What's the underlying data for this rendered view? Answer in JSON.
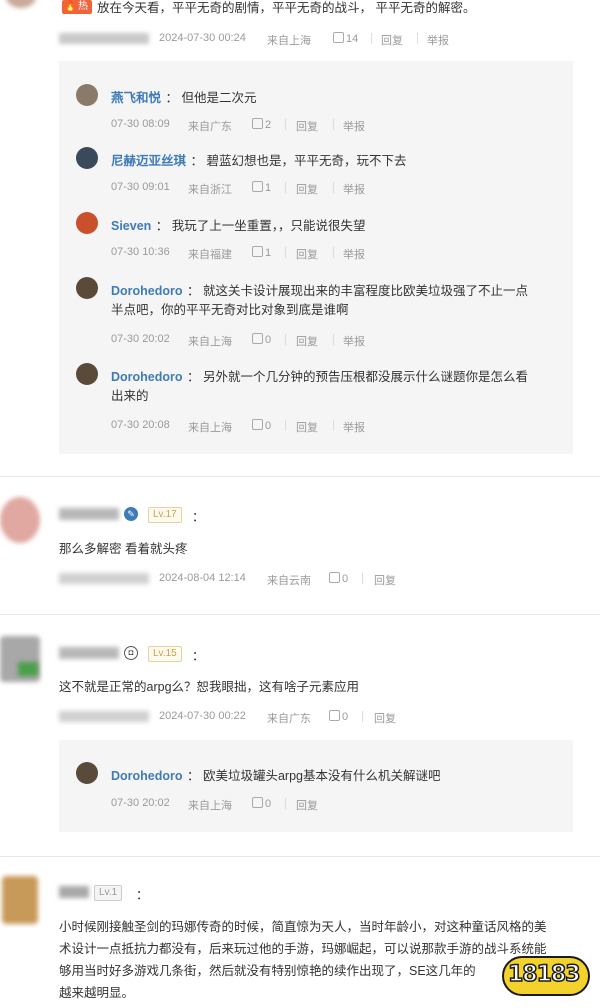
{
  "top_comment": {
    "hot_badge": "热",
    "text": "放在今天看，平平无奇的剧情，平平无奇的战斗， 平平无奇的解密。",
    "date": "2024-07-30 00:24",
    "location": "来自上海",
    "likes": "14",
    "reply_label": "回复",
    "report_label": "举报",
    "replies": [
      {
        "name": "燕飞和悦",
        "text": "但他是二次元",
        "date": "07-30 08:09",
        "location": "来自广东",
        "likes": "2",
        "reply_label": "回复",
        "report_label": "举报",
        "avatar_color": "#8a7a6a"
      },
      {
        "name": "尼赫迈亚丝琪",
        "text": "碧蓝幻想也是，平平无奇，玩不下去",
        "date": "07-30 09:01",
        "location": "来自浙江",
        "likes": "1",
        "reply_label": "回复",
        "report_label": "举报",
        "avatar_color": "#3a4a5a"
      },
      {
        "name": "Sieven",
        "text": "我玩了上一坐重置，，只能说很失望",
        "date": "07-30 10:36",
        "location": "来自福建",
        "likes": "1",
        "reply_label": "回复",
        "report_label": "举报",
        "avatar_color": "#c8502a"
      },
      {
        "name": "Dorohedoro",
        "text_line1": "就这关卡设计展现出来的丰富程度比欧美垃圾强了不止一点",
        "text_line2": "半点吧，你的平平无奇对比对象到底是谁啊",
        "date": "07-30 20:02",
        "location": "来自上海",
        "likes": "0",
        "reply_label": "回复",
        "report_label": "举报",
        "avatar_color": "#5a4a3a"
      },
      {
        "name": "Dorohedoro",
        "text_line1": "另外就一个几分钟的预告压根都没展示什么谜题你是怎么看",
        "text_line2": "出来的",
        "date": "07-30 20:08",
        "location": "来自上海",
        "likes": "0",
        "reply_label": "回复",
        "report_label": "举报",
        "avatar_color": "#5a4a3a"
      }
    ]
  },
  "comment2": {
    "level": "Lv.17",
    "text": "那么多解密 看着就头疼",
    "date": "2024-08-04 12:14",
    "location": "来自云南",
    "likes": "0",
    "reply_label": "回复"
  },
  "comment3": {
    "level": "Lv.15",
    "text": "这不就是正常的arpg么？恕我眼拙，这有啥子元素应用",
    "date": "2024-07-30 00:22",
    "location": "来自广东",
    "likes": "0",
    "reply_label": "回复",
    "reply": {
      "name": "Dorohedoro",
      "text": "欧美垃圾罐头arpg基本没有什么机关解谜吧",
      "date": "07-30 20:02",
      "location": "来自上海",
      "likes": "0",
      "reply_label": "回复"
    }
  },
  "comment4": {
    "level": "Lv.1",
    "line1": "小时候刚接触圣剑的玛娜传奇的时候，简直惊为天人，当时年龄小，对这种童话风格的美",
    "line2": "术设计一点抵抗力都没有，后来玩过他的手游，玛娜崛起，可以说那款手游的战斗系统能",
    "line3": "够用当时好多游戏几条街，然后就没有特别惊艳的续作出现了，SE这几年的",
    "line4": "越来越明显。"
  },
  "watermark": {
    "text": "18183"
  },
  "colors": {
    "accent_name": "#3e7bb8",
    "level": "#c8a24a",
    "hot": "#f0643c"
  }
}
